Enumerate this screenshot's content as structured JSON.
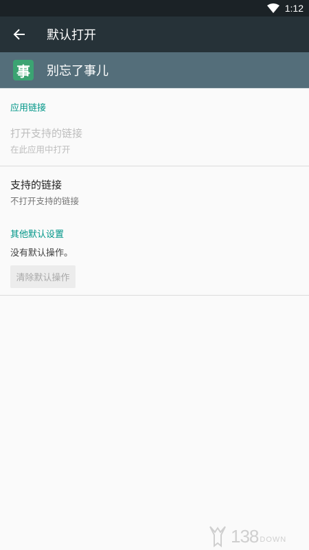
{
  "status_bar": {
    "time": "1:12"
  },
  "app_bar": {
    "title": "默认打开"
  },
  "app_header": {
    "icon_char": "事",
    "name": "别忘了事儿"
  },
  "app_links": {
    "section_title": "应用链接",
    "open_supported": {
      "title": "打开支持的链接",
      "summary": "在此应用中打开"
    },
    "supported_links": {
      "title": "支持的链接",
      "summary": "不打开支持的链接"
    }
  },
  "other_defaults": {
    "section_title": "其他默认设置",
    "summary": "没有默认操作。",
    "clear_button": "清除默认操作"
  },
  "watermark": {
    "number": "138",
    "suffix": "DOWN"
  },
  "colors": {
    "status_bar": "#1b2226",
    "app_bar": "#263238",
    "app_header": "#546e7a",
    "accent": "#009688",
    "app_icon": "#3ba372"
  }
}
